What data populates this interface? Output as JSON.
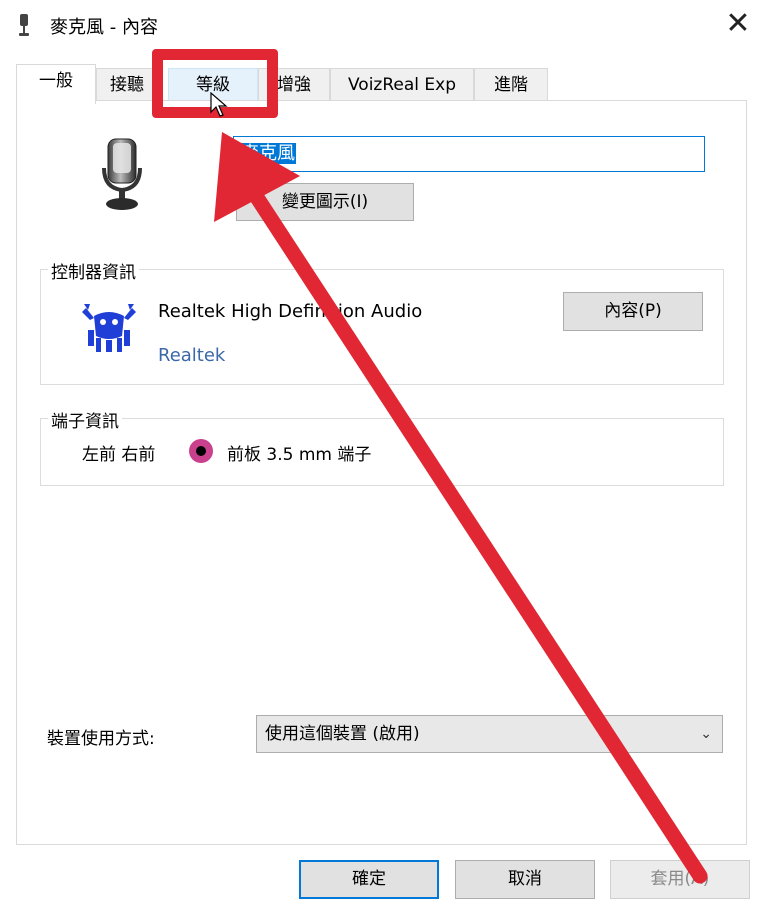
{
  "window": {
    "title": "麥克風 - 內容",
    "close_glyph": "✕"
  },
  "tabs": [
    {
      "label": "一般",
      "state": "active"
    },
    {
      "label": "接聽",
      "state": "normal"
    },
    {
      "label": "等級",
      "state": "hover"
    },
    {
      "label": "增強",
      "state": "normal"
    },
    {
      "label": "VoizReal Exp",
      "state": "normal"
    },
    {
      "label": "進階",
      "state": "normal"
    }
  ],
  "general": {
    "device_name_value": "麥克風",
    "change_icon_label": "變更圖示(I)",
    "mic_icon": "microphone-icon"
  },
  "controller": {
    "group_label": "控制器資訊",
    "name": "Realtek High Definition Audio",
    "vendor_link": "Realtek",
    "properties_label": "內容(P)",
    "logo": "realtek-crab-logo"
  },
  "jack": {
    "group_label": "端子資訊",
    "location": "左前 右前",
    "jack_color": "#c9408c",
    "description": "前板 3.5 mm 端子"
  },
  "usage": {
    "label": "裝置使用方式:",
    "selected": "使用這個裝置 (啟用)"
  },
  "footer": {
    "ok_label": "確定",
    "cancel_label": "取消",
    "apply_label": "套用(A)"
  },
  "annotation": {
    "color": "#e02733"
  }
}
